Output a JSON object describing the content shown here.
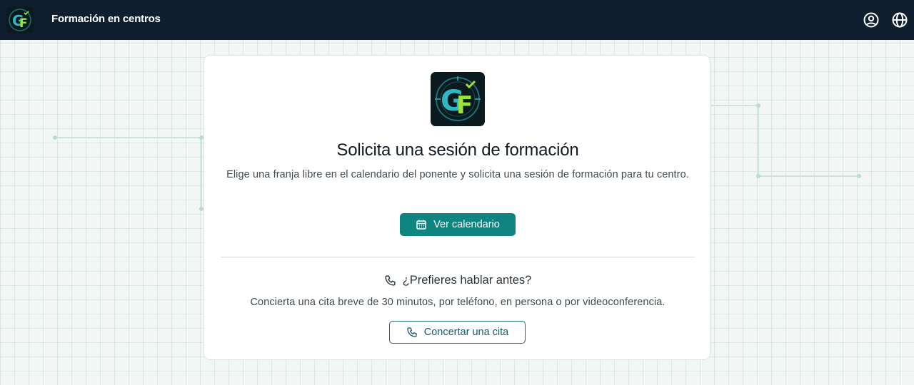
{
  "header": {
    "app_title": "Formación en centros",
    "logo_icon": "gf-logo-icon",
    "profile_icon": "user-circle-icon",
    "language_icon": "globe-icon",
    "background_color": "#0f1f2f"
  },
  "card": {
    "logo_icon": "gf-logo-icon",
    "title": "Solicita una sesión de formación",
    "description": "Elige una franja libre en el calendario del ponente y solicita una sesión de formación para tu centro.",
    "primary_button": {
      "label": "Ver calendario",
      "icon": "calendar-icon",
      "color": "#0e8581"
    },
    "secondary": {
      "question": "¿Prefieres hablar antes?",
      "question_icon": "phone-icon",
      "description": "Concierta una cita breve de 30 minutos, por teléfono, en persona o por videoconferencia.",
      "button_label": "Concertar una cita",
      "button_icon": "phone-icon"
    }
  },
  "colors": {
    "accent": "#0e8581",
    "page_background": "#f2f7f5"
  }
}
